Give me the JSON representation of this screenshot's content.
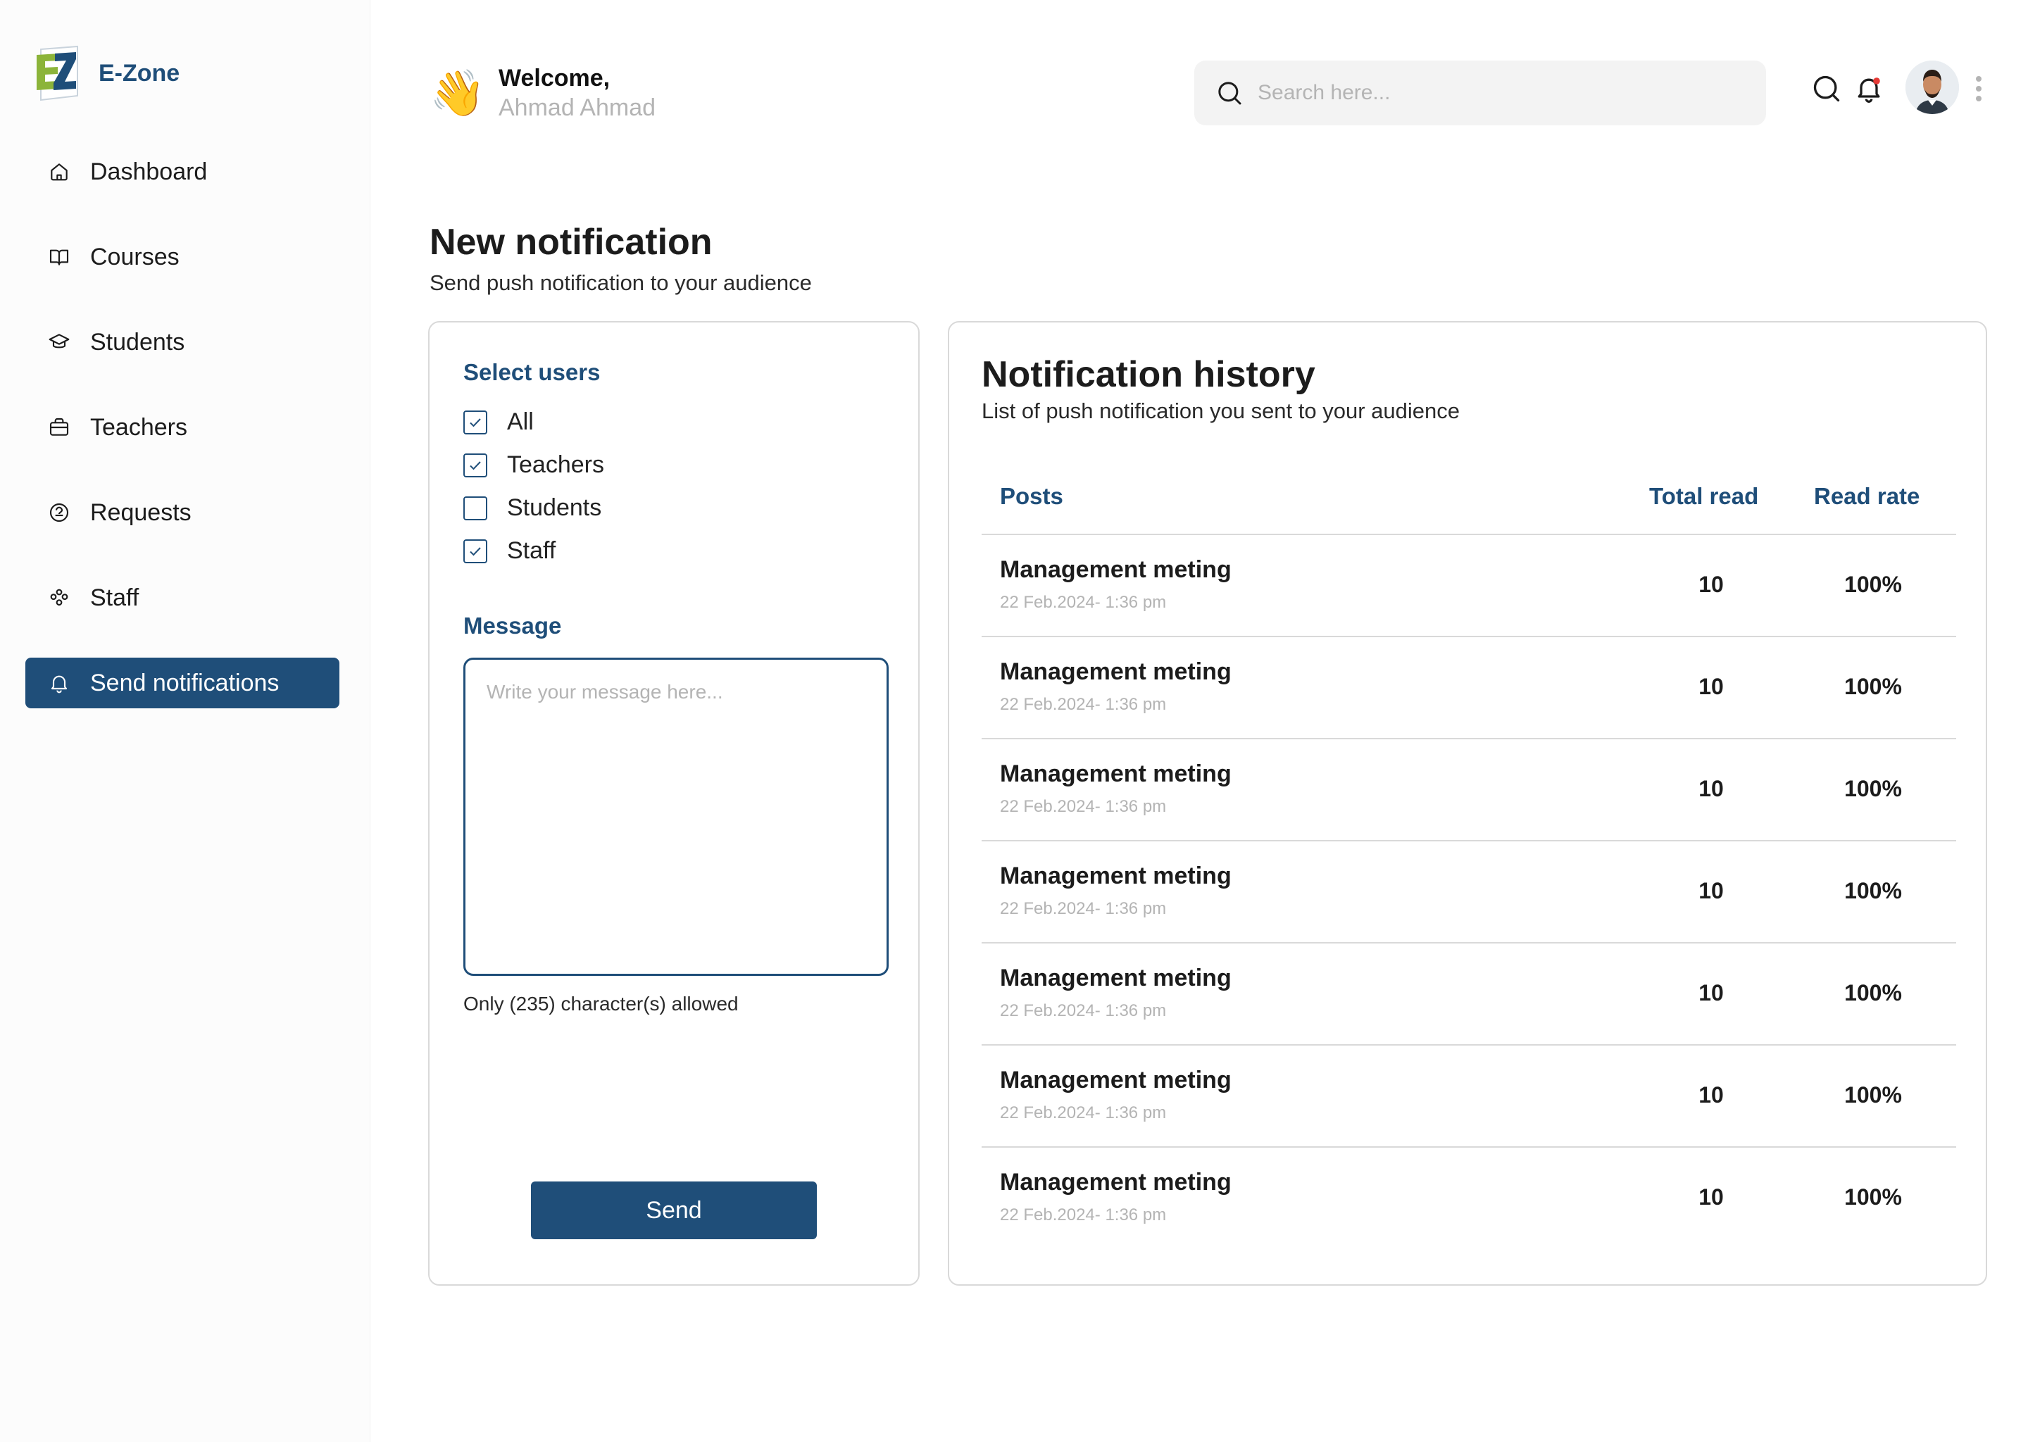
{
  "brand": {
    "name": "E-Zone"
  },
  "sidebar": {
    "items": [
      {
        "label": "Dashboard",
        "icon": "home-icon"
      },
      {
        "label": "Courses",
        "icon": "book-icon"
      },
      {
        "label": "Students",
        "icon": "graduation-cap-icon"
      },
      {
        "label": "Teachers",
        "icon": "briefcase-icon"
      },
      {
        "label": "Requests",
        "icon": "requests-icon"
      },
      {
        "label": "Staff",
        "icon": "people-icon"
      },
      {
        "label": "Send notifications",
        "icon": "bell-icon",
        "active": true
      }
    ]
  },
  "header": {
    "welcome_title": "Welcome,",
    "welcome_name": "Ahmad Ahmad",
    "wave_emoji": "👋",
    "search_placeholder": "Search here...",
    "icons": [
      "search-icon",
      "bell-icon",
      "avatar",
      "kebab-menu-icon"
    ]
  },
  "page": {
    "title": "New notification",
    "subtitle": "Send push notification to your audience"
  },
  "compose": {
    "select_users_label": "Select users",
    "options": [
      {
        "label": "All",
        "checked": true
      },
      {
        "label": "Teachers",
        "checked": true
      },
      {
        "label": "Students",
        "checked": false
      },
      {
        "label": "Staff",
        "checked": true
      }
    ],
    "message_label": "Message",
    "message_placeholder": "Write your message here...",
    "char_note": "Only (235) character(s) allowed",
    "send_label": "Send"
  },
  "history": {
    "title": "Notification history",
    "subtitle": "List of  push notification you sent to your audience",
    "columns": [
      "Posts",
      "Total read",
      "Read rate"
    ],
    "rows": [
      {
        "title": "Management meting",
        "date": "22 Feb.2024- 1:36 pm",
        "total_read": "10",
        "read_rate": "100%"
      },
      {
        "title": "Management meting",
        "date": "22 Feb.2024- 1:36 pm",
        "total_read": "10",
        "read_rate": "100%"
      },
      {
        "title": "Management meting",
        "date": "22 Feb.2024- 1:36 pm",
        "total_read": "10",
        "read_rate": "100%"
      },
      {
        "title": "Management meting",
        "date": "22 Feb.2024- 1:36 pm",
        "total_read": "10",
        "read_rate": "100%"
      },
      {
        "title": "Management meting",
        "date": "22 Feb.2024- 1:36 pm",
        "total_read": "10",
        "read_rate": "100%"
      },
      {
        "title": "Management meting",
        "date": "22 Feb.2024- 1:36 pm",
        "total_read": "10",
        "read_rate": "100%"
      },
      {
        "title": "Management meting",
        "date": "22 Feb.2024- 1:36 pm",
        "total_read": "10",
        "read_rate": "100%"
      }
    ]
  },
  "colors": {
    "primary": "#1f4e79",
    "logo_green": "#8cb43a",
    "muted_text": "#b4b4b4",
    "border": "#d9d9d9",
    "notification_dot": "#e53935"
  }
}
